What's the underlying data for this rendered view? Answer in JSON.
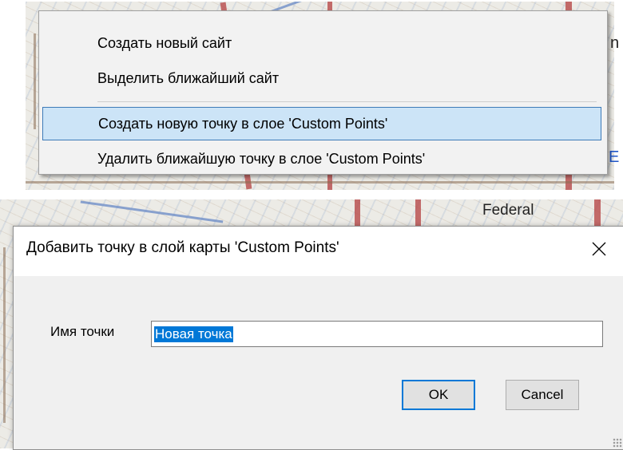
{
  "map": {
    "fragment_letter_n": "n",
    "link_letter_e": "E",
    "fragment_federal": "Federal"
  },
  "context_menu": {
    "items": [
      {
        "label": "Создать новый сайт"
      },
      {
        "label": "Выделить ближайший сайт"
      },
      {
        "label": "Создать новую точку в слое 'Custom Points'",
        "highlighted": true
      },
      {
        "label": "Удалить ближайшую точку в слое 'Custom Points'"
      }
    ]
  },
  "dialog": {
    "title": "Добавить точку в слой карты 'Custom Points'",
    "close_icon": "close-icon",
    "field_label": "Имя точки",
    "field_value": "Новая точка",
    "ok_label": "OK",
    "cancel_label": "Cancel"
  },
  "colors": {
    "menu_highlight": "#cce4f7",
    "menu_highlight_border": "#3d7ab8",
    "selection": "#0078d7",
    "default_button_border": "#0078d7"
  }
}
